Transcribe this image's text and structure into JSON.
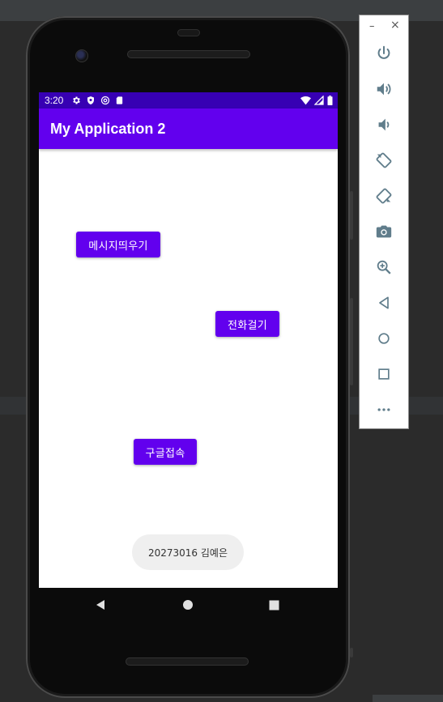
{
  "app": {
    "title": "My Application 2"
  },
  "status_bar": {
    "time": "3:20",
    "left_icons": [
      "settings-icon",
      "shield-icon",
      "at-sign-icon",
      "sd-card-icon"
    ],
    "right_icons": [
      "wifi-icon",
      "signal-icon",
      "battery-icon"
    ]
  },
  "buttons": {
    "message": "메시지띄우기",
    "call": "전화걸기",
    "google": "구글접속"
  },
  "toast": {
    "text": "20273016 김예은"
  },
  "nav": [
    "back-icon",
    "home-icon",
    "recents-icon"
  ],
  "emulator_toolbar": {
    "minimize": "–",
    "close": "×",
    "items": [
      "power-icon",
      "volume-up-icon",
      "volume-down-icon",
      "rotate-left-icon",
      "rotate-right-icon",
      "camera-icon",
      "zoom-icon",
      "back-icon",
      "home-icon",
      "overview-icon",
      "more-icon"
    ]
  },
  "colors": {
    "primary": "#6200ee",
    "primary_dark": "#3700b3",
    "toolbar_icon": "#607d8b"
  }
}
